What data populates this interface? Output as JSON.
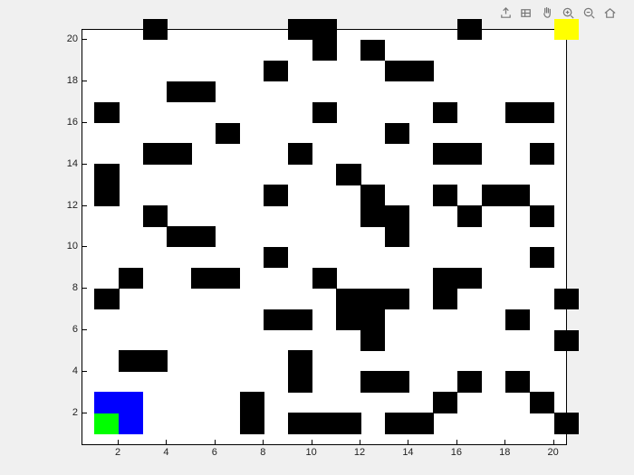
{
  "chart_data": {
    "type": "heatmap",
    "title": "",
    "xlabel": "",
    "ylabel": "",
    "xlim": [
      0.5,
      20.5
    ],
    "ylim": [
      0.5,
      20.5
    ],
    "xticks": [
      2,
      4,
      6,
      8,
      10,
      12,
      14,
      16,
      18,
      20
    ],
    "yticks": [
      2,
      4,
      6,
      8,
      10,
      12,
      14,
      16,
      18,
      20
    ],
    "color_map": {
      "0": "white",
      "1": "black",
      "2": "green",
      "3": "blue",
      "4": "yellow"
    },
    "cells": [
      {
        "x": 1,
        "y": 1,
        "v": 2
      },
      {
        "x": 2,
        "y": 1,
        "v": 3
      },
      {
        "x": 7,
        "y": 1,
        "v": 1
      },
      {
        "x": 9,
        "y": 1,
        "v": 1
      },
      {
        "x": 10,
        "y": 1,
        "v": 1
      },
      {
        "x": 11,
        "y": 1,
        "v": 1
      },
      {
        "x": 13,
        "y": 1,
        "v": 1
      },
      {
        "x": 14,
        "y": 1,
        "v": 1
      },
      {
        "x": 20,
        "y": 1,
        "v": 1
      },
      {
        "x": 1,
        "y": 2,
        "v": 3
      },
      {
        "x": 2,
        "y": 2,
        "v": 3
      },
      {
        "x": 7,
        "y": 2,
        "v": 1
      },
      {
        "x": 15,
        "y": 2,
        "v": 1
      },
      {
        "x": 19,
        "y": 2,
        "v": 1
      },
      {
        "x": 9,
        "y": 3,
        "v": 1
      },
      {
        "x": 12,
        "y": 3,
        "v": 1
      },
      {
        "x": 13,
        "y": 3,
        "v": 1
      },
      {
        "x": 16,
        "y": 3,
        "v": 1
      },
      {
        "x": 18,
        "y": 3,
        "v": 1
      },
      {
        "x": 2,
        "y": 4,
        "v": 1
      },
      {
        "x": 3,
        "y": 4,
        "v": 1
      },
      {
        "x": 9,
        "y": 4,
        "v": 1
      },
      {
        "x": 12,
        "y": 5,
        "v": 1
      },
      {
        "x": 20,
        "y": 5,
        "v": 1
      },
      {
        "x": 8,
        "y": 6,
        "v": 1
      },
      {
        "x": 9,
        "y": 6,
        "v": 1
      },
      {
        "x": 11,
        "y": 6,
        "v": 1
      },
      {
        "x": 12,
        "y": 6,
        "v": 1
      },
      {
        "x": 18,
        "y": 6,
        "v": 1
      },
      {
        "x": 1,
        "y": 7,
        "v": 1
      },
      {
        "x": 11,
        "y": 7,
        "v": 1
      },
      {
        "x": 12,
        "y": 7,
        "v": 1
      },
      {
        "x": 13,
        "y": 7,
        "v": 1
      },
      {
        "x": 15,
        "y": 7,
        "v": 1
      },
      {
        "x": 20,
        "y": 7,
        "v": 1
      },
      {
        "x": 2,
        "y": 8,
        "v": 1
      },
      {
        "x": 5,
        "y": 8,
        "v": 1
      },
      {
        "x": 6,
        "y": 8,
        "v": 1
      },
      {
        "x": 10,
        "y": 8,
        "v": 1
      },
      {
        "x": 15,
        "y": 8,
        "v": 1
      },
      {
        "x": 16,
        "y": 8,
        "v": 1
      },
      {
        "x": 8,
        "y": 9,
        "v": 1
      },
      {
        "x": 19,
        "y": 9,
        "v": 1
      },
      {
        "x": 4,
        "y": 10,
        "v": 1
      },
      {
        "x": 5,
        "y": 10,
        "v": 1
      },
      {
        "x": 13,
        "y": 10,
        "v": 1
      },
      {
        "x": 3,
        "y": 11,
        "v": 1
      },
      {
        "x": 12,
        "y": 11,
        "v": 1
      },
      {
        "x": 13,
        "y": 11,
        "v": 1
      },
      {
        "x": 16,
        "y": 11,
        "v": 1
      },
      {
        "x": 19,
        "y": 11,
        "v": 1
      },
      {
        "x": 1,
        "y": 12,
        "v": 1
      },
      {
        "x": 8,
        "y": 12,
        "v": 1
      },
      {
        "x": 12,
        "y": 12,
        "v": 1
      },
      {
        "x": 15,
        "y": 12,
        "v": 1
      },
      {
        "x": 17,
        "y": 12,
        "v": 1
      },
      {
        "x": 18,
        "y": 12,
        "v": 1
      },
      {
        "x": 1,
        "y": 13,
        "v": 1
      },
      {
        "x": 11,
        "y": 13,
        "v": 1
      },
      {
        "x": 3,
        "y": 14,
        "v": 1
      },
      {
        "x": 4,
        "y": 14,
        "v": 1
      },
      {
        "x": 9,
        "y": 14,
        "v": 1
      },
      {
        "x": 15,
        "y": 14,
        "v": 1
      },
      {
        "x": 16,
        "y": 14,
        "v": 1
      },
      {
        "x": 19,
        "y": 14,
        "v": 1
      },
      {
        "x": 6,
        "y": 15,
        "v": 1
      },
      {
        "x": 13,
        "y": 15,
        "v": 1
      },
      {
        "x": 1,
        "y": 16,
        "v": 1
      },
      {
        "x": 10,
        "y": 16,
        "v": 1
      },
      {
        "x": 15,
        "y": 16,
        "v": 1
      },
      {
        "x": 18,
        "y": 16,
        "v": 1
      },
      {
        "x": 19,
        "y": 16,
        "v": 1
      },
      {
        "x": 4,
        "y": 17,
        "v": 1
      },
      {
        "x": 5,
        "y": 17,
        "v": 1
      },
      {
        "x": 8,
        "y": 18,
        "v": 1
      },
      {
        "x": 13,
        "y": 18,
        "v": 1
      },
      {
        "x": 14,
        "y": 18,
        "v": 1
      },
      {
        "x": 10,
        "y": 19,
        "v": 1
      },
      {
        "x": 12,
        "y": 19,
        "v": 1
      },
      {
        "x": 3,
        "y": 20,
        "v": 1
      },
      {
        "x": 9,
        "y": 20,
        "v": 1
      },
      {
        "x": 10,
        "y": 20,
        "v": 1
      },
      {
        "x": 16,
        "y": 20,
        "v": 1
      },
      {
        "x": 20,
        "y": 20,
        "v": 4
      }
    ]
  },
  "toolbar": {
    "items": [
      "export-icon",
      "brush-icon",
      "pan-icon",
      "zoom-in-icon",
      "zoom-out-icon",
      "home-icon"
    ]
  }
}
